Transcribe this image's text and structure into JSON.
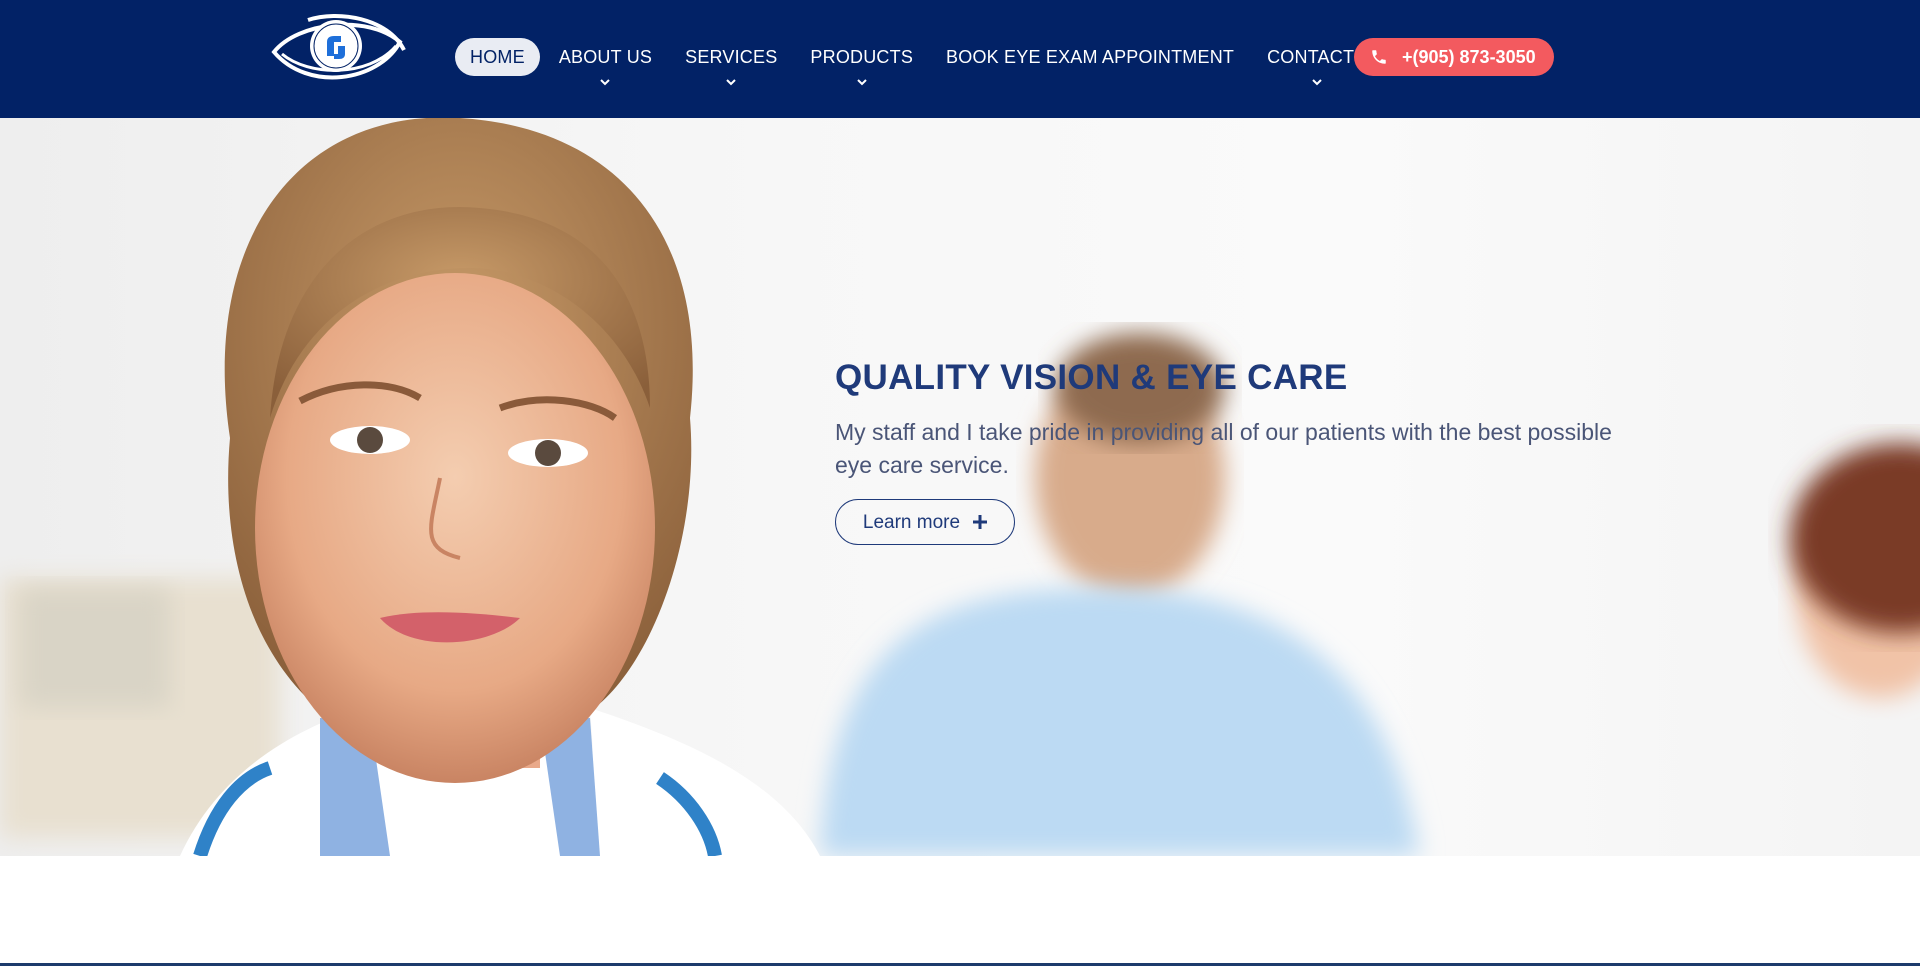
{
  "header": {
    "background_color": "#022266",
    "logo_icon": "eye-logo-icon",
    "nav": [
      {
        "label": "HOME",
        "active": true,
        "has_dropdown": false
      },
      {
        "label": "ABOUT US",
        "active": false,
        "has_dropdown": true
      },
      {
        "label": "SERVICES",
        "active": false,
        "has_dropdown": true
      },
      {
        "label": "PRODUCTS",
        "active": false,
        "has_dropdown": true
      },
      {
        "label": "BOOK EYE EXAM APPOINTMENT",
        "active": false,
        "has_dropdown": false
      },
      {
        "label": "CONTACTS",
        "active": false,
        "has_dropdown": true
      }
    ],
    "phone": {
      "label": "+(905) 873-3050",
      "icon": "phone-icon",
      "color": "#f35a5f"
    }
  },
  "hero": {
    "title": "QUALITY VISION & EYE CARE",
    "text": "My staff and I take pride in providing all of our patients with the best possible eye care service.",
    "button_label": "Learn more",
    "button_icon": "plus-icon",
    "title_color": "#1f3a7a"
  }
}
